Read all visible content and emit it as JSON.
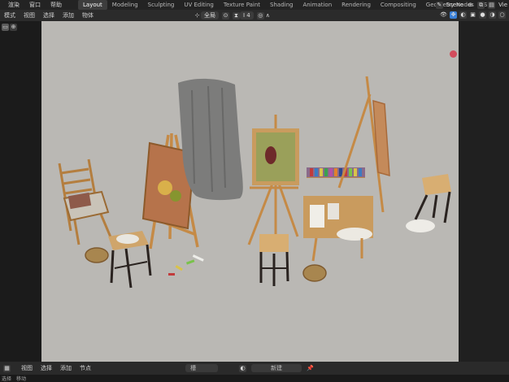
{
  "menu": [
    "渲染",
    "窗口",
    "帮助"
  ],
  "tabs": [
    {
      "label": "Layout",
      "active": true
    },
    {
      "label": "Modeling",
      "active": false
    },
    {
      "label": "Sculpting",
      "active": false
    },
    {
      "label": "UV Editing",
      "active": false
    },
    {
      "label": "Texture Paint",
      "active": false
    },
    {
      "label": "Shading",
      "active": false
    },
    {
      "label": "Animation",
      "active": false
    },
    {
      "label": "Rendering",
      "active": false
    },
    {
      "label": "Compositing",
      "active": false
    },
    {
      "label": "Geometry Nodes",
      "active": false
    },
    {
      "label": "S",
      "active": false
    }
  ],
  "scene_label": "Scene",
  "view_layer": "Vie",
  "viewport_header": {
    "mode": "模式",
    "menu": [
      "视图",
      "选择",
      "添加",
      "物体"
    ],
    "transform_orientation": "全局",
    "snap_label": "I 4"
  },
  "timeline": {
    "menu": [
      "视图",
      "选择",
      "添加",
      "节点"
    ],
    "slot_label": "槽",
    "new_button": "新建"
  },
  "status": {
    "left": "选择",
    "item": "移动"
  },
  "colors": {
    "viewport_bg": "#bab8b4",
    "active_tab": "#3d3d3d",
    "accent_blue": "#3a7fd6"
  }
}
